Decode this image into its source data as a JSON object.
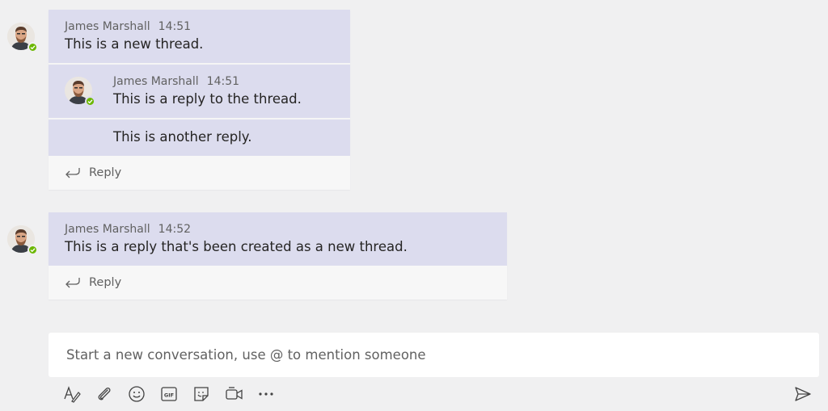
{
  "threads": [
    {
      "author": "James Marshall",
      "time": "14:51",
      "text": "This is a new thread.",
      "replies": [
        {
          "author": "James Marshall",
          "time": "14:51",
          "text": "This is a reply to the thread."
        },
        {
          "text": "This is another reply."
        }
      ],
      "reply_label": "Reply"
    },
    {
      "author": "James Marshall",
      "time": "14:52",
      "text": "This is a reply that's been created as a new thread.",
      "reply_label": "Reply"
    }
  ],
  "compose": {
    "placeholder": "Start a new conversation, use @ to mention someone"
  },
  "toolbar": {
    "icons": [
      "format-icon",
      "attach-icon",
      "emoji-icon",
      "gif-icon",
      "sticker-icon",
      "meet-now-icon",
      "more-options-icon"
    ],
    "gif_label": "GIF",
    "send_icon": "send-icon"
  },
  "colors": {
    "background": "#f0f0f1",
    "message_card": "#dcdcee",
    "presence_available": "#6bb700",
    "text_primary": "#252423",
    "text_secondary": "#616161"
  }
}
